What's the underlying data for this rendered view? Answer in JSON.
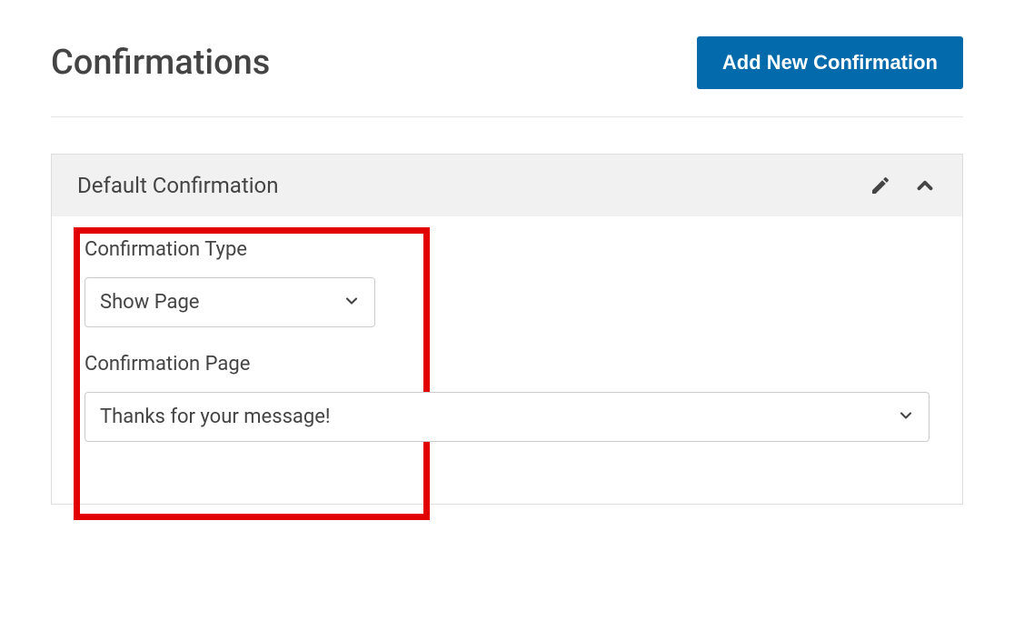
{
  "header": {
    "title": "Confirmations",
    "add_button_label": "Add New Confirmation"
  },
  "panel": {
    "title": "Default Confirmation",
    "confirmation_type": {
      "label": "Confirmation Type",
      "value": "Show Page"
    },
    "confirmation_page": {
      "label": "Confirmation Page",
      "value": "Thanks for your message!"
    }
  }
}
